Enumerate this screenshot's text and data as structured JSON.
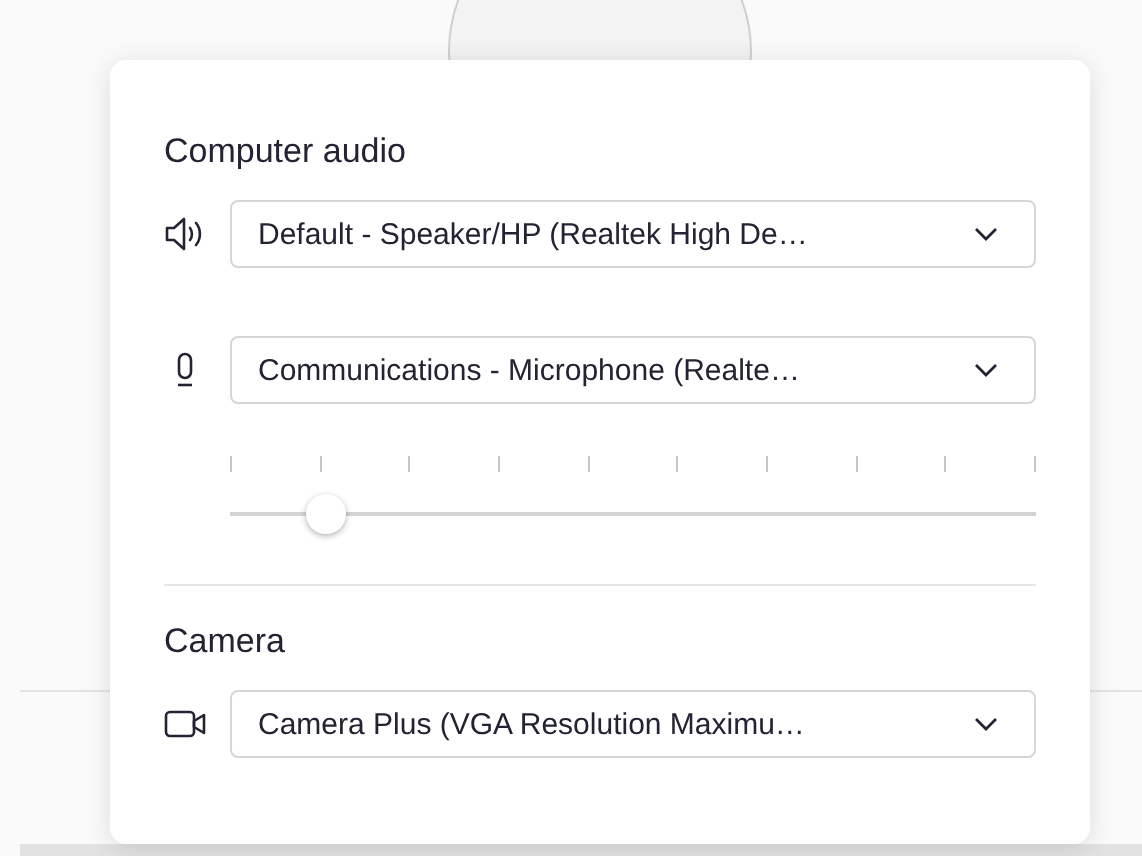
{
  "sections": [
    {
      "title": "Computer audio",
      "devices": [
        {
          "kind": "speaker",
          "value": "Default - Speaker/HP (Realtek High De…"
        },
        {
          "kind": "microphone",
          "value": "Communications - Microphone (Realte…",
          "level": 0.12
        }
      ]
    },
    {
      "title": "Camera",
      "devices": [
        {
          "kind": "camera",
          "value": "Camera Plus (VGA Resolution Maximu…"
        }
      ]
    }
  ]
}
